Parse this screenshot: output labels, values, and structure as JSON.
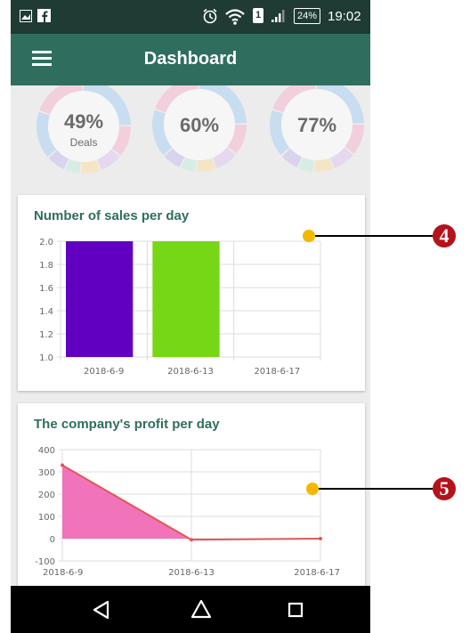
{
  "status_bar": {
    "time": "19:02",
    "battery": "24%",
    "sim": "1",
    "icons": [
      "image-icon",
      "facebook-icon",
      "alarm-icon",
      "wifi-icon",
      "sim-icon",
      "signal-icon",
      "battery-icon"
    ]
  },
  "app_bar": {
    "title": "Dashboard",
    "menu_icon": "hamburger-menu-icon"
  },
  "gauges": [
    {
      "value": "49%",
      "label": "Deals"
    },
    {
      "value": "60%",
      "label": ""
    },
    {
      "value": "77%",
      "label": ""
    }
  ],
  "callouts": [
    "4",
    "5"
  ],
  "nav_bar": {
    "icons": [
      "back-triangle-icon",
      "home-circle-icon",
      "recents-square-icon"
    ]
  },
  "colors": {
    "app_bar": "#2f6e5e",
    "bar_purple": "#6200c2",
    "bar_green": "#76d716",
    "area_fill": "#f06bb6",
    "area_line": "#e05757",
    "callout_dot": "#f5b800",
    "callout_number": "#b5121b"
  },
  "chart_data": [
    {
      "type": "bar",
      "title": "Number of sales per day",
      "categories": [
        "2018-6-9",
        "2018-6-13",
        "2018-6-17"
      ],
      "values": [
        2,
        2,
        null
      ],
      "y_ticks": [
        "2.0",
        "1.8",
        "1.6",
        "1.4",
        "1.2",
        "1.0"
      ],
      "ylim": [
        1.0,
        2.0
      ],
      "grid": true
    },
    {
      "type": "area",
      "title": "The company's profit per day",
      "x": [
        "2018-6-9",
        "2018-6-13",
        "2018-6-17"
      ],
      "values": [
        330,
        -5,
        0
      ],
      "y_ticks": [
        "400",
        "300",
        "200",
        "100",
        "0",
        "-100"
      ],
      "ylim": [
        -100,
        400
      ],
      "grid": true
    }
  ]
}
